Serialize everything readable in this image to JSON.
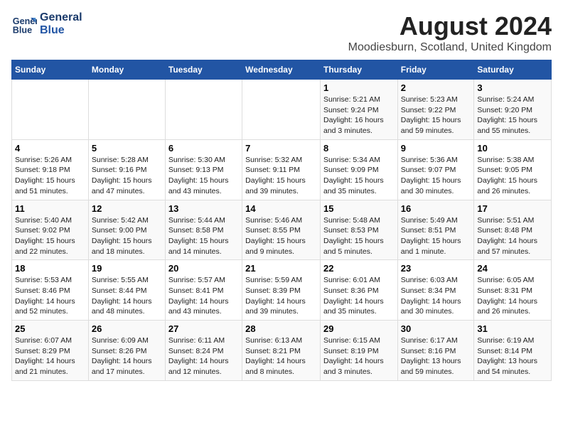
{
  "header": {
    "logo_line1": "General",
    "logo_line2": "Blue",
    "main_title": "August 2024",
    "sub_title": "Moodiesburn, Scotland, United Kingdom"
  },
  "days_of_week": [
    "Sunday",
    "Monday",
    "Tuesday",
    "Wednesday",
    "Thursday",
    "Friday",
    "Saturday"
  ],
  "weeks": [
    [
      {
        "num": "",
        "info": ""
      },
      {
        "num": "",
        "info": ""
      },
      {
        "num": "",
        "info": ""
      },
      {
        "num": "",
        "info": ""
      },
      {
        "num": "1",
        "info": "Sunrise: 5:21 AM\nSunset: 9:24 PM\nDaylight: 16 hours\nand 3 minutes."
      },
      {
        "num": "2",
        "info": "Sunrise: 5:23 AM\nSunset: 9:22 PM\nDaylight: 15 hours\nand 59 minutes."
      },
      {
        "num": "3",
        "info": "Sunrise: 5:24 AM\nSunset: 9:20 PM\nDaylight: 15 hours\nand 55 minutes."
      }
    ],
    [
      {
        "num": "4",
        "info": "Sunrise: 5:26 AM\nSunset: 9:18 PM\nDaylight: 15 hours\nand 51 minutes."
      },
      {
        "num": "5",
        "info": "Sunrise: 5:28 AM\nSunset: 9:16 PM\nDaylight: 15 hours\nand 47 minutes."
      },
      {
        "num": "6",
        "info": "Sunrise: 5:30 AM\nSunset: 9:13 PM\nDaylight: 15 hours\nand 43 minutes."
      },
      {
        "num": "7",
        "info": "Sunrise: 5:32 AM\nSunset: 9:11 PM\nDaylight: 15 hours\nand 39 minutes."
      },
      {
        "num": "8",
        "info": "Sunrise: 5:34 AM\nSunset: 9:09 PM\nDaylight: 15 hours\nand 35 minutes."
      },
      {
        "num": "9",
        "info": "Sunrise: 5:36 AM\nSunset: 9:07 PM\nDaylight: 15 hours\nand 30 minutes."
      },
      {
        "num": "10",
        "info": "Sunrise: 5:38 AM\nSunset: 9:05 PM\nDaylight: 15 hours\nand 26 minutes."
      }
    ],
    [
      {
        "num": "11",
        "info": "Sunrise: 5:40 AM\nSunset: 9:02 PM\nDaylight: 15 hours\nand 22 minutes."
      },
      {
        "num": "12",
        "info": "Sunrise: 5:42 AM\nSunset: 9:00 PM\nDaylight: 15 hours\nand 18 minutes."
      },
      {
        "num": "13",
        "info": "Sunrise: 5:44 AM\nSunset: 8:58 PM\nDaylight: 15 hours\nand 14 minutes."
      },
      {
        "num": "14",
        "info": "Sunrise: 5:46 AM\nSunset: 8:55 PM\nDaylight: 15 hours\nand 9 minutes."
      },
      {
        "num": "15",
        "info": "Sunrise: 5:48 AM\nSunset: 8:53 PM\nDaylight: 15 hours\nand 5 minutes."
      },
      {
        "num": "16",
        "info": "Sunrise: 5:49 AM\nSunset: 8:51 PM\nDaylight: 15 hours\nand 1 minute."
      },
      {
        "num": "17",
        "info": "Sunrise: 5:51 AM\nSunset: 8:48 PM\nDaylight: 14 hours\nand 57 minutes."
      }
    ],
    [
      {
        "num": "18",
        "info": "Sunrise: 5:53 AM\nSunset: 8:46 PM\nDaylight: 14 hours\nand 52 minutes."
      },
      {
        "num": "19",
        "info": "Sunrise: 5:55 AM\nSunset: 8:44 PM\nDaylight: 14 hours\nand 48 minutes."
      },
      {
        "num": "20",
        "info": "Sunrise: 5:57 AM\nSunset: 8:41 PM\nDaylight: 14 hours\nand 43 minutes."
      },
      {
        "num": "21",
        "info": "Sunrise: 5:59 AM\nSunset: 8:39 PM\nDaylight: 14 hours\nand 39 minutes."
      },
      {
        "num": "22",
        "info": "Sunrise: 6:01 AM\nSunset: 8:36 PM\nDaylight: 14 hours\nand 35 minutes."
      },
      {
        "num": "23",
        "info": "Sunrise: 6:03 AM\nSunset: 8:34 PM\nDaylight: 14 hours\nand 30 minutes."
      },
      {
        "num": "24",
        "info": "Sunrise: 6:05 AM\nSunset: 8:31 PM\nDaylight: 14 hours\nand 26 minutes."
      }
    ],
    [
      {
        "num": "25",
        "info": "Sunrise: 6:07 AM\nSunset: 8:29 PM\nDaylight: 14 hours\nand 21 minutes."
      },
      {
        "num": "26",
        "info": "Sunrise: 6:09 AM\nSunset: 8:26 PM\nDaylight: 14 hours\nand 17 minutes."
      },
      {
        "num": "27",
        "info": "Sunrise: 6:11 AM\nSunset: 8:24 PM\nDaylight: 14 hours\nand 12 minutes."
      },
      {
        "num": "28",
        "info": "Sunrise: 6:13 AM\nSunset: 8:21 PM\nDaylight: 14 hours\nand 8 minutes."
      },
      {
        "num": "29",
        "info": "Sunrise: 6:15 AM\nSunset: 8:19 PM\nDaylight: 14 hours\nand 3 minutes."
      },
      {
        "num": "30",
        "info": "Sunrise: 6:17 AM\nSunset: 8:16 PM\nDaylight: 13 hours\nand 59 minutes."
      },
      {
        "num": "31",
        "info": "Sunrise: 6:19 AM\nSunset: 8:14 PM\nDaylight: 13 hours\nand 54 minutes."
      }
    ]
  ]
}
